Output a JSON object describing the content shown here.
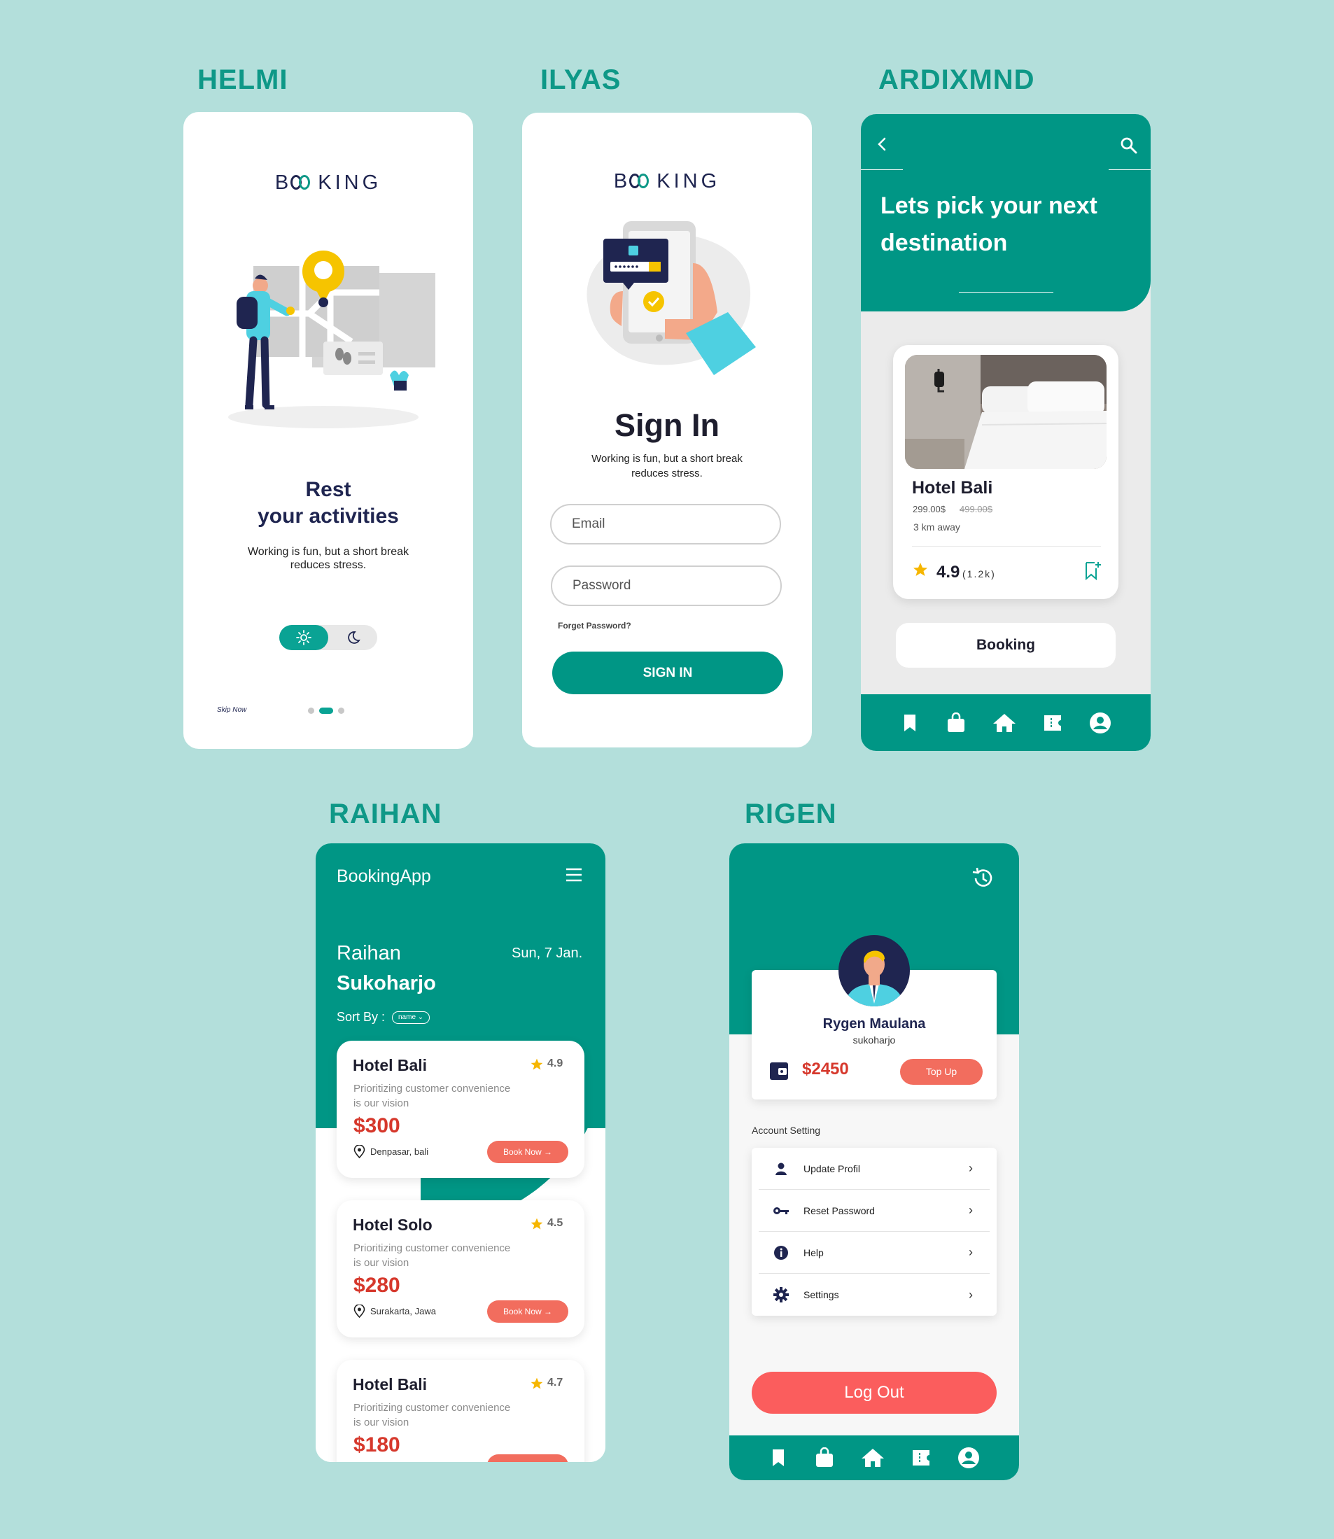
{
  "labels": {
    "helmi": "HELMI",
    "ilyas": "ILYAS",
    "ardix": "ARDIXMND",
    "raihan": "RAIHAN",
    "rigen": "RIGEN"
  },
  "brand": {
    "logo_pre": "B",
    "logo_post": "KING"
  },
  "helmi": {
    "title_line1": "Rest",
    "title_line2": "your activities",
    "subtitle_line1": "Working is fun, but a short break",
    "subtitle_line2": "reduces stress.",
    "skip": "Skip Now",
    "theme_toggle": {
      "light_icon": "sun-icon",
      "dark_icon": "moon-icon"
    },
    "pager": {
      "total": 3,
      "active": 2
    }
  },
  "ilyas": {
    "title": "Sign In",
    "subtitle_line1": "Working is fun, but a short break",
    "subtitle_line2": "reduces stress.",
    "email_placeholder": "Email",
    "password_placeholder": "Password",
    "forgot": "Forget Password?",
    "signin_button": "SIGN IN"
  },
  "ardix": {
    "heading_line1": "Lets pick your next",
    "heading_line2": "destination",
    "hotel_name": "Hotel Bali",
    "price": "299.00$",
    "old_price": "499.00$",
    "distance": "3 km away",
    "rating": "4.9",
    "rating_count": "(1.2k)",
    "booking_button": "Booking",
    "nav": [
      "bookmark-icon",
      "bag-icon",
      "home-icon",
      "ticket-icon",
      "profile-icon"
    ]
  },
  "raihan": {
    "app_title": "BookingApp",
    "user_first": "Raihan",
    "user_city": "Sukoharjo",
    "date": "Sun, 7 Jan.",
    "sort_label": "Sort By :",
    "sort_value": "name ⌄",
    "hotels": [
      {
        "name": "Hotel Bali",
        "rating": "4.9",
        "desc_line1": "Prioritizing customer convenience",
        "desc_line2": "is our vision",
        "price": "$300",
        "location": "Denpasar, bali",
        "button": "Book Now →"
      },
      {
        "name": "Hotel Solo",
        "rating": "4.5",
        "desc_line1": "Prioritizing customer convenience",
        "desc_line2": "is our vision",
        "price": "$280",
        "location": "Surakarta, Jawa",
        "button": "Book Now →"
      },
      {
        "name": "Hotel Bali",
        "rating": "4.7",
        "desc_line1": "Prioritizing customer convenience",
        "desc_line2": "is our vision",
        "price": "$180"
      }
    ]
  },
  "rigen": {
    "name": "Rygen Maulana",
    "city": "sukoharjo",
    "balance": "$2450",
    "topup": "Top Up",
    "section": "Account Setting",
    "menu": [
      {
        "label": "Update Profil",
        "icon": "user-icon"
      },
      {
        "label": "Reset Password",
        "icon": "key-icon"
      },
      {
        "label": "Help",
        "icon": "info-icon"
      },
      {
        "label": "Settings",
        "icon": "gear-icon"
      }
    ],
    "logout": "Log Out",
    "nav": [
      "bookmark-icon",
      "bag-icon",
      "home-icon",
      "ticket-icon",
      "profile-icon"
    ]
  },
  "colors": {
    "background": "#b3dfdb",
    "teal": "#009685",
    "navy": "#1f2550",
    "coral": "#f26d5e",
    "price_red": "#d6382c",
    "logout_red": "#fb5d5d"
  }
}
